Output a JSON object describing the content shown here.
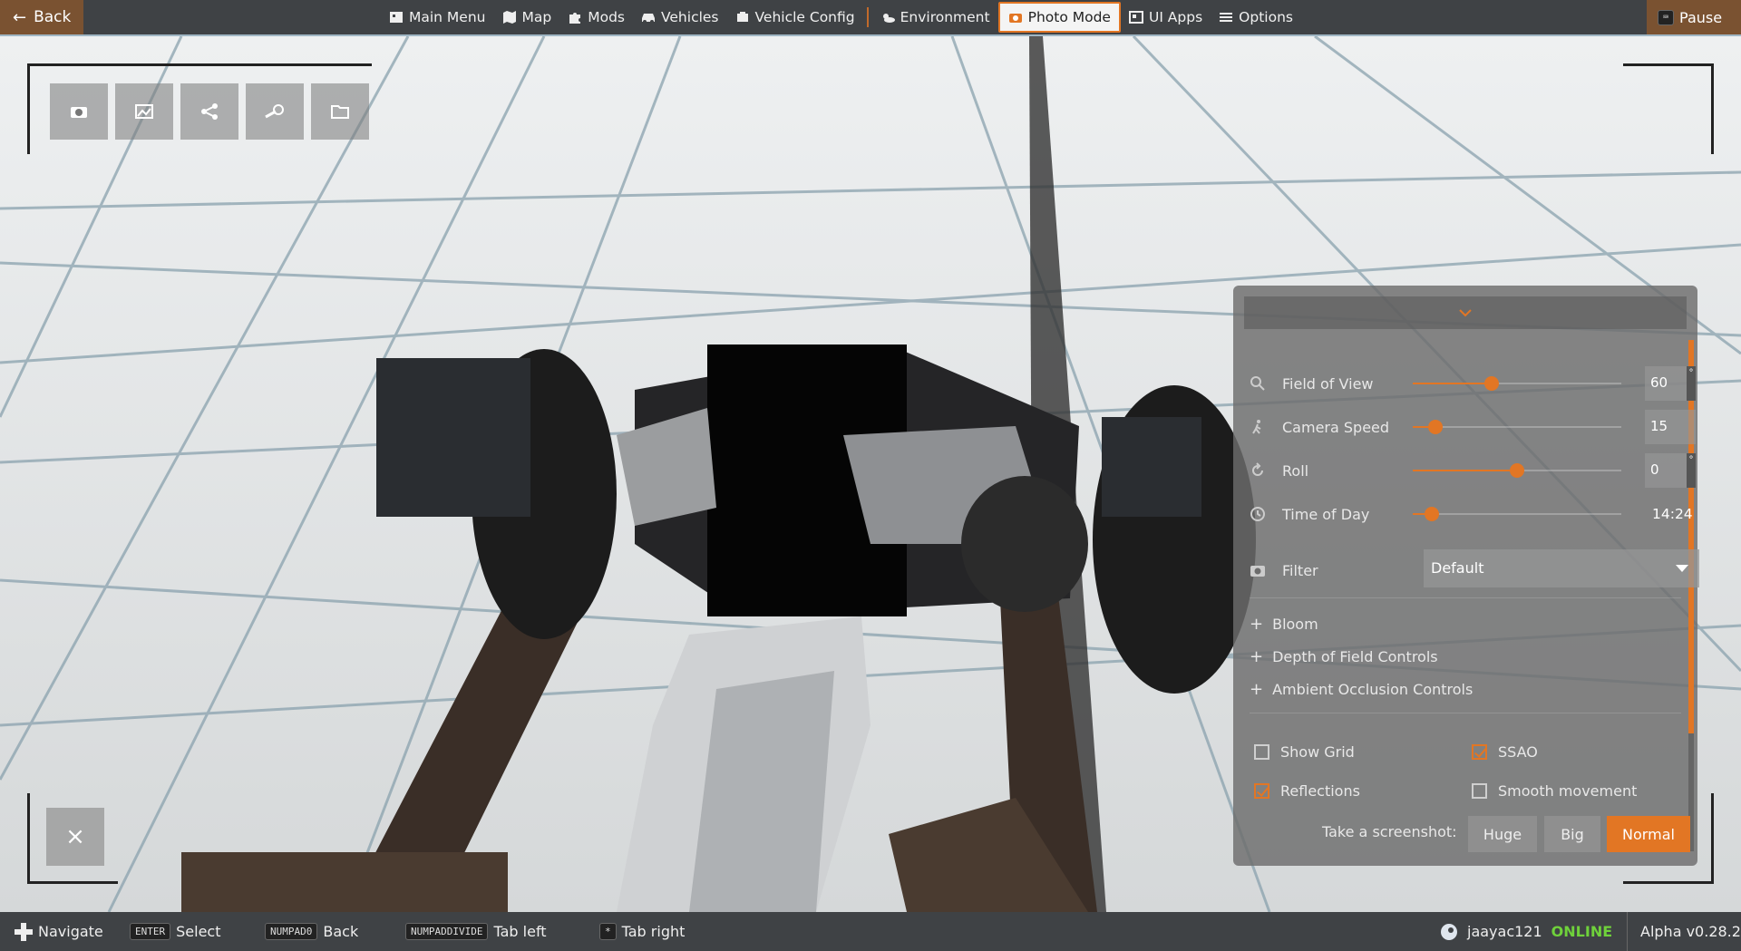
{
  "topbar": {
    "back_label": "Back",
    "pause_label": "Pause",
    "menu": [
      {
        "label": "Main Menu",
        "icon": "main-menu-icon"
      },
      {
        "label": "Map",
        "icon": "map-icon"
      },
      {
        "label": "Mods",
        "icon": "puzzle-icon"
      },
      {
        "label": "Vehicles",
        "icon": "car-icon"
      },
      {
        "label": "Vehicle Config",
        "icon": "engine-icon"
      },
      {
        "label": "Environment",
        "icon": "weather-icon"
      },
      {
        "label": "Photo Mode",
        "icon": "camera-icon",
        "active": true
      },
      {
        "label": "UI Apps",
        "icon": "ui-apps-icon"
      },
      {
        "label": "Options",
        "icon": "sliders-icon"
      }
    ]
  },
  "toolbar": {
    "tools": [
      "camera-icon",
      "image-icon",
      "share-icon",
      "steam-icon",
      "folder-icon"
    ],
    "close_icon": "close-icon"
  },
  "panel": {
    "sliders": [
      {
        "label": "Field of View",
        "value": "60",
        "unit": "°",
        "level": 0.38,
        "icon": "zoom-icon"
      },
      {
        "label": "Camera Speed",
        "value": "15",
        "unit": "",
        "level": 0.11,
        "icon": "walk-icon"
      },
      {
        "label": "Roll",
        "value": "0",
        "unit": "°",
        "level": 0.5,
        "icon": "rotate-icon"
      },
      {
        "label": "Time of Day",
        "value": "14:24",
        "unit": "",
        "level": 0.09,
        "icon": "clock-icon"
      }
    ],
    "filter": {
      "label": "Filter",
      "value": "Default"
    },
    "expanders": [
      "Bloom",
      "Depth of Field Controls",
      "Ambient Occlusion Controls"
    ],
    "checkboxes": [
      {
        "label": "Show Grid",
        "checked": false
      },
      {
        "label": "SSAO",
        "checked": true
      },
      {
        "label": "Reflections",
        "checked": true
      },
      {
        "label": "Smooth movement",
        "checked": false
      }
    ],
    "screenshot": {
      "label": "Take a screenshot:",
      "buttons": [
        "Huge",
        "Big",
        "Normal"
      ]
    }
  },
  "bottombar": {
    "hints": [
      {
        "key": "",
        "label": "Navigate"
      },
      {
        "key": "ENTER",
        "label": "Select"
      },
      {
        "key": "NUMPAD0",
        "label": "Back"
      },
      {
        "key": "NUMPADDIVIDE",
        "label": "Tab left"
      },
      {
        "key": "*",
        "label": "Tab right"
      }
    ],
    "username": "jaayac121",
    "status": "ONLINE",
    "version": "Alpha v0.28.2"
  },
  "colors": {
    "accent": "#e27624",
    "bar": "#3f4245",
    "online": "#6fd13b"
  }
}
